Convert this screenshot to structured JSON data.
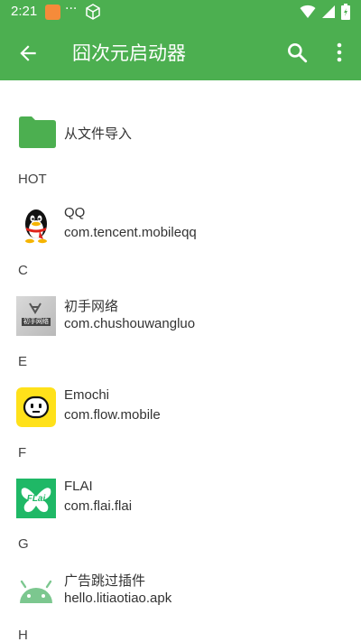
{
  "status_bar": {
    "time": "2:21",
    "overflow": "···",
    "icons": [
      "app-notification-icon",
      "cube-icon",
      "wifi-icon",
      "signal-icon",
      "battery-icon"
    ]
  },
  "app_bar": {
    "title": "囧次元启动器",
    "background": "#4caf50",
    "icons": [
      "arrow-left-icon",
      "search-icon",
      "more-vert-icon"
    ]
  },
  "import_item": {
    "label": "从文件导入",
    "icon": "folder-icon",
    "color": "#4caf50"
  },
  "sections": [
    {
      "header": "HOT",
      "apps": [
        {
          "name": "QQ",
          "package": "com.tencent.mobileqq",
          "icon": "qq-penguin-icon"
        }
      ]
    },
    {
      "header": "C",
      "apps": [
        {
          "name": "初手网络",
          "package": "com.chushouwangluo",
          "icon": "chushou-logo-icon",
          "logo_text": "初手网络"
        }
      ]
    },
    {
      "header": "E",
      "apps": [
        {
          "name": "Emochi",
          "package": "com.flow.mobile",
          "icon": "emochi-face-icon",
          "color": "#ffe11a"
        }
      ]
    },
    {
      "header": "F",
      "apps": [
        {
          "name": "FLAI",
          "package": "com.flai.flai",
          "icon": "flai-logo-icon",
          "color": "#1fb866",
          "logo_text": "FLai"
        }
      ]
    },
    {
      "header": "G",
      "apps": [
        {
          "name": "广告跳过插件",
          "package": "hello.litiaotiao.apk",
          "icon": "android-robot-icon",
          "color": "#7cc78f"
        }
      ]
    },
    {
      "header": "H",
      "apps": []
    }
  ]
}
